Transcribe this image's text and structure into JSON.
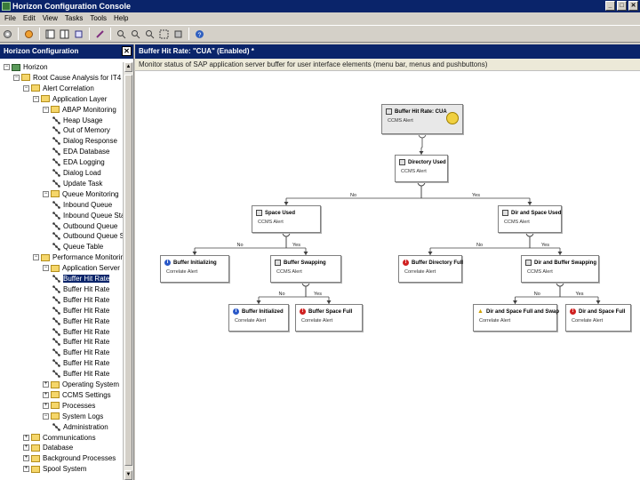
{
  "window": {
    "title": "Horizon Configuration Console",
    "buttons": [
      "_",
      "□",
      "✕"
    ]
  },
  "menu": [
    "File",
    "Edit",
    "View",
    "Tasks",
    "Tools",
    "Help"
  ],
  "toolbar": {
    "icons": [
      "gear-icon",
      "refresh-icon",
      "layout-icon",
      "layout-split-icon",
      "export-icon",
      "pen-icon",
      "zoom-in-icon",
      "zoom-out-icon",
      "zoom-reset-icon",
      "zoom-fit-icon",
      "zoom-select-icon",
      "help-icon"
    ]
  },
  "left_pane": {
    "title": "Horizon Configuration",
    "close": "✕",
    "tree": [
      {
        "label": "Horizon",
        "level": 0,
        "type": "root",
        "expander": "−"
      },
      {
        "label": "Root Cause Analysis for IT4",
        "level": 1,
        "type": "folder",
        "expander": "−"
      },
      {
        "label": "Alert Correlation",
        "level": 2,
        "type": "folder",
        "expander": "−"
      },
      {
        "label": "Application Layer",
        "level": 3,
        "type": "folder",
        "expander": "−"
      },
      {
        "label": "ABAP Monitoring",
        "level": 4,
        "type": "folder",
        "expander": "−"
      },
      {
        "label": "Heap Usage",
        "level": 5,
        "type": "node"
      },
      {
        "label": "Out of Memory",
        "level": 5,
        "type": "node"
      },
      {
        "label": "Dialog Response",
        "level": 5,
        "type": "node"
      },
      {
        "label": "EDA Database",
        "level": 5,
        "type": "node"
      },
      {
        "label": "EDA Logging",
        "level": 5,
        "type": "node"
      },
      {
        "label": "Dialog Load",
        "level": 5,
        "type": "node"
      },
      {
        "label": "Update Task",
        "level": 5,
        "type": "node"
      },
      {
        "label": "Queue Monitoring",
        "level": 4,
        "type": "folder",
        "expander": "−"
      },
      {
        "label": "Inbound Queue",
        "level": 5,
        "type": "node"
      },
      {
        "label": "Inbound Queue Status",
        "level": 5,
        "type": "node"
      },
      {
        "label": "Outbound Queue",
        "level": 5,
        "type": "node"
      },
      {
        "label": "Outbound Queue Status",
        "level": 5,
        "type": "node"
      },
      {
        "label": "Queue Table",
        "level": 5,
        "type": "node"
      },
      {
        "label": "Performance Monitoring",
        "level": 3,
        "type": "folder",
        "expander": "−"
      },
      {
        "label": "Application Server",
        "level": 4,
        "type": "folder",
        "expander": "−"
      },
      {
        "label": "Buffer Hit Rate",
        "level": 5,
        "type": "node",
        "selected": true
      },
      {
        "label": "Buffer Hit Rate",
        "level": 5,
        "type": "node"
      },
      {
        "label": "Buffer Hit Rate",
        "level": 5,
        "type": "node"
      },
      {
        "label": "Buffer Hit Rate",
        "level": 5,
        "type": "node"
      },
      {
        "label": "Buffer Hit Rate",
        "level": 5,
        "type": "node"
      },
      {
        "label": "Buffer Hit Rate",
        "level": 5,
        "type": "node"
      },
      {
        "label": "Buffer Hit Rate",
        "level": 5,
        "type": "node"
      },
      {
        "label": "Buffer Hit Rate",
        "level": 5,
        "type": "node"
      },
      {
        "label": "Buffer Hit Rate",
        "level": 5,
        "type": "node"
      },
      {
        "label": "Buffer Hit Rate",
        "level": 5,
        "type": "node"
      },
      {
        "label": "Operating System",
        "level": 4,
        "type": "folder",
        "expander": "+"
      },
      {
        "label": "CCMS Settings",
        "level": 4,
        "type": "folder",
        "expander": "+"
      },
      {
        "label": "Processes",
        "level": 4,
        "type": "folder",
        "expander": "+"
      },
      {
        "label": "System Logs",
        "level": 4,
        "type": "folder",
        "expander": "−"
      },
      {
        "label": "Administration",
        "level": 5,
        "type": "node"
      },
      {
        "label": "Communications",
        "level": 2,
        "type": "folder",
        "expander": "+"
      },
      {
        "label": "Database",
        "level": 2,
        "type": "folder",
        "expander": "+"
      },
      {
        "label": "Background Processes",
        "level": 2,
        "type": "folder",
        "expander": "+"
      },
      {
        "label": "Spool System",
        "level": 2,
        "type": "folder",
        "expander": "+"
      }
    ]
  },
  "document": {
    "title": "Buffer Hit Rate: \"CUA\" (Enabled) *",
    "description": "Monitor status of SAP application server buffer for user interface elements (menu bar, menus and pushbuttons)"
  },
  "flow": {
    "nodes": [
      {
        "id": "root",
        "title": "Buffer Hit Rate: CUA",
        "sub": "CCMS Alert",
        "icon": "grid"
      },
      {
        "id": "dir",
        "title": "Directory Used",
        "sub": "CCMS Alert",
        "icon": "grid"
      },
      {
        "id": "space",
        "title": "Space Used",
        "sub": "CCMS Alert",
        "icon": "grid"
      },
      {
        "id": "dirspace",
        "title": "Dir and Space Used",
        "sub": "CCMS Alert",
        "icon": "grid"
      },
      {
        "id": "init",
        "title": "Buffer Initializing",
        "sub": "Correlate Alert",
        "icon": "info"
      },
      {
        "id": "swap",
        "title": "Buffer Swapping",
        "sub": "CCMS Alert",
        "icon": "grid"
      },
      {
        "id": "dirfull",
        "title": "Buffer Directory Full",
        "sub": "Correlate Alert",
        "icon": "err"
      },
      {
        "id": "dirswap",
        "title": "Dir and Buffer Swapping",
        "sub": "CCMS Alert",
        "icon": "grid"
      },
      {
        "id": "inited",
        "title": "Buffer Initialized",
        "sub": "Correlate Alert",
        "icon": "info"
      },
      {
        "id": "spacefull",
        "title": "Buffer Space Full",
        "sub": "Correlate Alert",
        "icon": "err"
      },
      {
        "id": "dirspaceswap",
        "title": "Dir and Space Full and Swap",
        "sub": "Correlate Alert",
        "icon": "warn"
      },
      {
        "id": "dirspacefull",
        "title": "Dir and Space Full",
        "sub": "Correlate Alert",
        "icon": "err"
      }
    ],
    "branch_labels": {
      "no": "No",
      "yes": "Yes"
    }
  }
}
